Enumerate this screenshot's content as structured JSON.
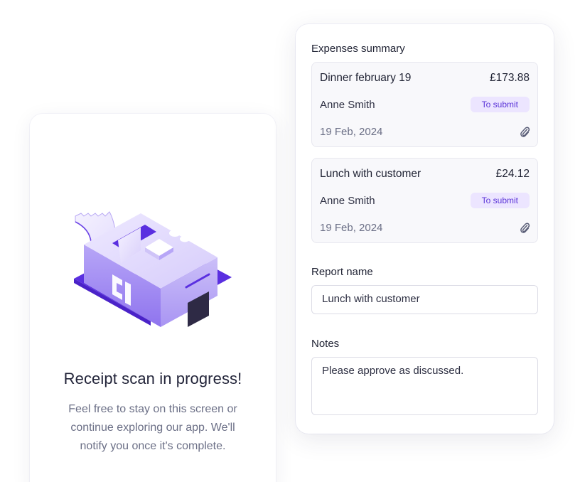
{
  "scan": {
    "title": "Receipt scan in progress!",
    "description": "Feel free to stay on this screen or continue exploring our app. We'll notify you once it's complete."
  },
  "summary": {
    "title": "Expenses summary",
    "expenses": [
      {
        "title": "Dinner february 19",
        "amount": "£173.88",
        "person": "Anne Smith",
        "status": "To submit",
        "date": "19 Feb, 2024",
        "attachment_icon": "paperclip-icon"
      },
      {
        "title": "Lunch with customer",
        "amount": "£24.12",
        "person": "Anne Smith",
        "status": "To submit",
        "date": "19 Feb, 2024",
        "attachment_icon": "paperclip-icon"
      }
    ]
  },
  "form": {
    "report_name_label": "Report name",
    "report_name_value": "Lunch with customer",
    "notes_label": "Notes",
    "notes_value": "Please approve as discussed."
  },
  "colors": {
    "accent": "#5b34d8",
    "badge_bg": "#ece5ff",
    "illustration_light": "#c9bdf7",
    "illustration_dark": "#5a2fe0"
  }
}
